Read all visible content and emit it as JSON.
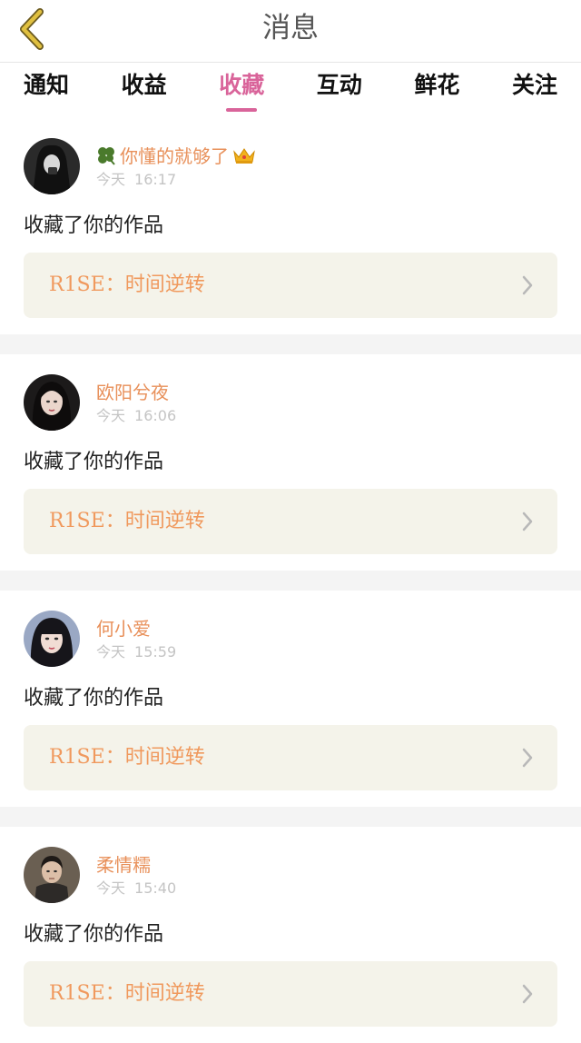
{
  "header": {
    "title": "消息"
  },
  "tabs": [
    {
      "label": "通知"
    },
    {
      "label": "收益"
    },
    {
      "label": "收藏"
    },
    {
      "label": "互动"
    },
    {
      "label": "鲜花"
    },
    {
      "label": "关注"
    }
  ],
  "active_tab": "收藏",
  "colors": {
    "accent": "#d9649a",
    "username": "#e8905a",
    "work_title": "#f0995d",
    "work_card_bg": "#f4f3ea",
    "back_arrow": "#e0c040"
  },
  "messages": [
    {
      "username": "你懂的就够了",
      "name_prefix_icon": "clover-icon",
      "name_suffix_icon": "crown-icon",
      "date": "今天",
      "time": "16:17",
      "action": "收藏了你的作品",
      "work_title": "R1SE：时间逆转"
    },
    {
      "username": "欧阳兮夜",
      "date": "今天",
      "time": "16:06",
      "action": "收藏了你的作品",
      "work_title": "R1SE：时间逆转"
    },
    {
      "username": "何小爱",
      "date": "今天",
      "time": "15:59",
      "action": "收藏了你的作品",
      "work_title": "R1SE：时间逆转"
    },
    {
      "username": "柔情糯",
      "date": "今天",
      "time": "15:40",
      "action": "收藏了你的作品",
      "work_title": "R1SE：时间逆转"
    }
  ]
}
